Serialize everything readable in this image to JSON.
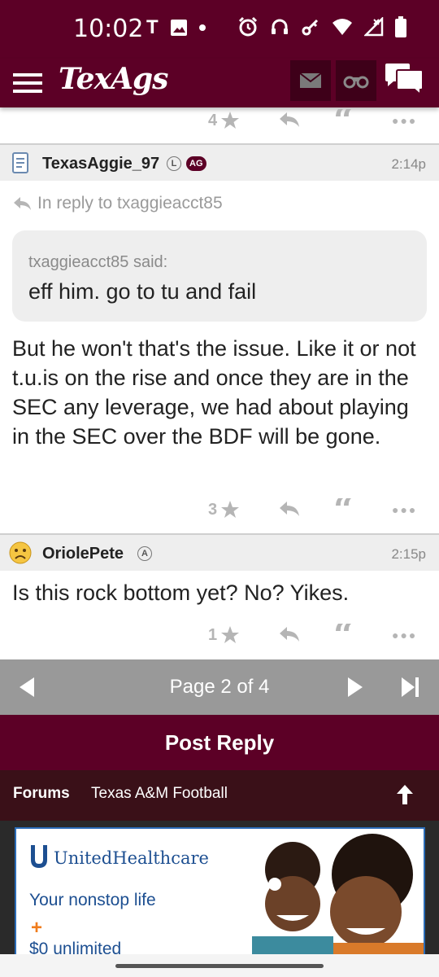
{
  "status_bar": {
    "time": "10:02",
    "carrier_icon": "T"
  },
  "header": {
    "logo": "TexAgs",
    "icons": [
      "menu-icon",
      "mail-icon",
      "binoculars-icon",
      "chat-icon"
    ]
  },
  "top_actions": {
    "rating": "4"
  },
  "posts": [
    {
      "username": "TexasAggie_97",
      "badges": [
        "L",
        "AG"
      ],
      "time": "2:14p",
      "in_reply_to": "In reply to txaggieacct85",
      "quote": {
        "author": "txaggieacct85 said:",
        "text": "eff him. go to tu and fail"
      },
      "body": "But he won't that's the issue. Like it or not t.u.is on the rise and once they are in the SEC any leverage, we had about playing in the SEC over the BDF will be gone.",
      "rating": "3"
    },
    {
      "username": "OriolePete",
      "badges": [
        "A"
      ],
      "time": "2:15p",
      "body": "Is this rock bottom yet? No? Yikes.",
      "rating": "1"
    }
  ],
  "pager": {
    "text": "Page 2 of 4"
  },
  "post_reply": {
    "label": "Post Reply"
  },
  "breadcrumb": {
    "forums": "Forums",
    "section": "Texas A&M Football"
  },
  "ad": {
    "brand": "UnitedHealthcare",
    "tagline": "Your nonstop life",
    "plus": "+",
    "line2": "$0 unlimited"
  },
  "colors": {
    "maroon": "#5c0026",
    "dark_maroon": "#3a1018",
    "pager_gray": "#999999",
    "icon_gray": "#b5b5b5"
  }
}
